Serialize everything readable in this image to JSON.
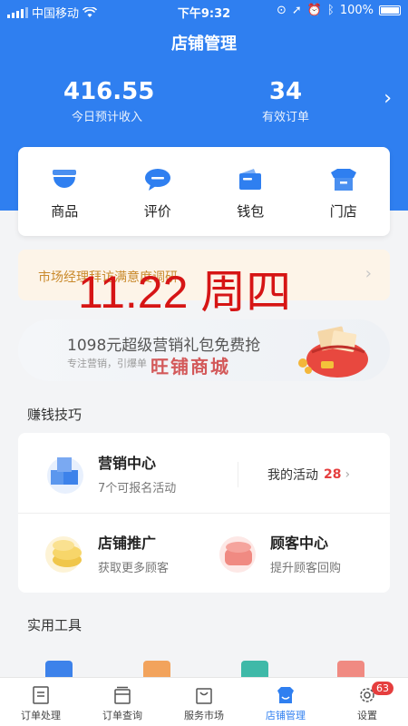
{
  "status_bar": {
    "carrier": "中国移动",
    "time": "下午9:32",
    "battery": "100%"
  },
  "header": {
    "title": "店铺管理"
  },
  "stats": [
    {
      "value": "416.55",
      "label": "今日预计收入"
    },
    {
      "value": "34",
      "label": "有效订单"
    }
  ],
  "quick_actions": [
    {
      "label": "商品",
      "icon": "bowl-icon"
    },
    {
      "label": "评价",
      "icon": "chat-bubble-icon"
    },
    {
      "label": "钱包",
      "icon": "wallet-icon"
    },
    {
      "label": "门店",
      "icon": "storefront-icon"
    }
  ],
  "notice": {
    "text": "市场经理拜访满意度调研",
    "overlay_date": "11.22 周四"
  },
  "promo": {
    "title": "1098元超级营销礼包免费抢",
    "subtitle": "专注营销，引爆单",
    "watermark": "旺铺商城"
  },
  "earn_tips": {
    "title": "赚钱技巧",
    "marketing": {
      "name": "营销中心",
      "sub": "7个可报名活动",
      "my_activity_label": "我的活动",
      "my_activity_count": "28"
    },
    "promotion": {
      "name": "店铺推广",
      "sub": "获取更多顾客"
    },
    "customer": {
      "name": "顾客中心",
      "sub": "提升顾客回购"
    }
  },
  "tools": {
    "title": "实用工具"
  },
  "tabbar": {
    "items": [
      {
        "label": "订单处理"
      },
      {
        "label": "订单查询"
      },
      {
        "label": "服务市场"
      },
      {
        "label": "店铺管理"
      },
      {
        "label": "设置"
      }
    ],
    "settings_badge": "63"
  },
  "colors": {
    "primary": "#2f7ff0",
    "notice_text": "#c98a2c",
    "badge": "#e53e3e",
    "stamp": "#d61515"
  }
}
